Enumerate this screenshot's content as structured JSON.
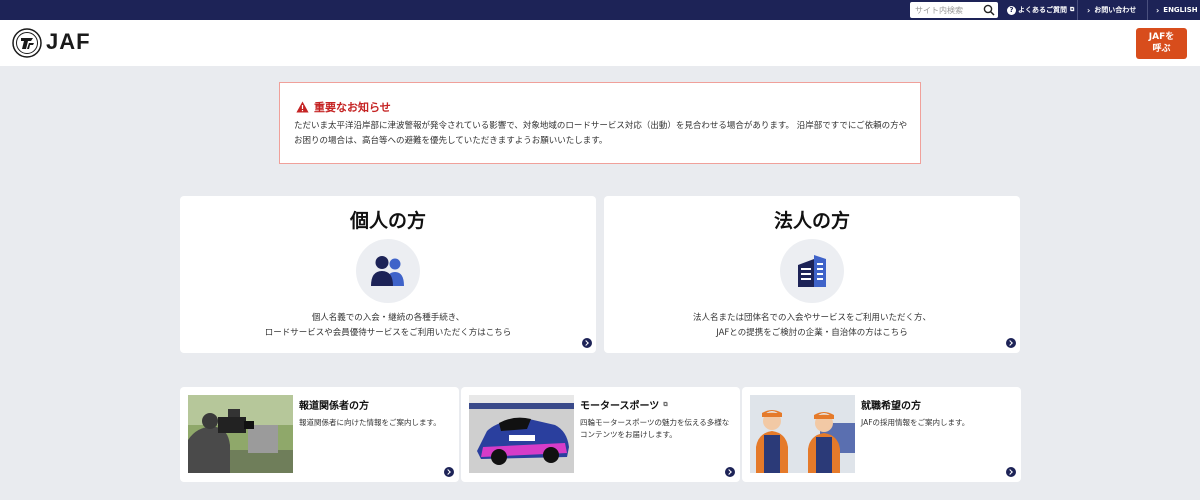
{
  "topbar": {
    "search_placeholder": "サイト内検索",
    "faq_label": "よくあるご質問",
    "contact_label": "お問い合わせ",
    "english_label": "ENGLISH",
    "ext_icon": "external-link-icon"
  },
  "header": {
    "logo_text": "JAF",
    "call_line1": "JAFを",
    "call_line2": "呼ぶ",
    "call_color": "#d84d1c"
  },
  "notice": {
    "title": "重要なお知らせ",
    "body": "ただいま太平洋沿岸部に津波警報が発令されている影響で、対象地域のロードサービス対応（出動）を見合わせる場合があります。 沿岸部ですでにご依頼の方やお困りの場合は、高台等への避難を優先していただきますようお願いいたします。",
    "title_color": "#c52424"
  },
  "cards": {
    "individual": {
      "title": "個人の方",
      "desc1": "個人名義での入会・継続の各種手続き、",
      "desc2": "ロードサービスや会員優待サービスをご利用いただく方はこちら"
    },
    "corporate": {
      "title": "法人の方",
      "desc1": "法人名または団体名での入会やサービスをご利用いただく方、",
      "desc2": "JAFとの提携をご検討の企業・自治体の方はこちら"
    }
  },
  "subcards": {
    "press": {
      "title": "報道関係者の方",
      "desc": "報道関係者に向けた情報をご案内します。"
    },
    "motorsports": {
      "title": "モータースポーツ",
      "desc": "四輪モータースポーツの魅力を伝える多様なコンテンツをお届けします。"
    },
    "careers": {
      "title": "就職希望の方",
      "desc": "JAFの採用情報をご案内します。"
    }
  },
  "colors": {
    "navy": "#1d2357",
    "accent_blue": "#3f63c9"
  }
}
